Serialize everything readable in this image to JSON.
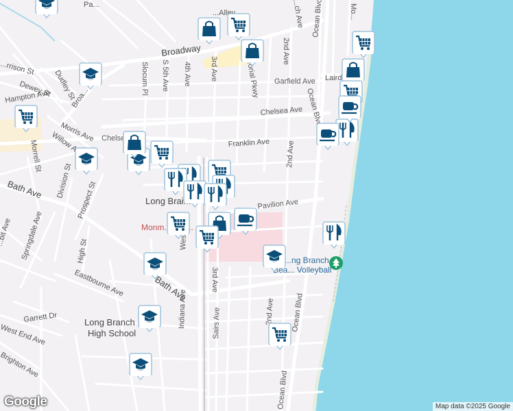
{
  "colors": {
    "water": "#8ed7ea",
    "land": "#f3f1f4",
    "road": "#ffffff",
    "major_road": "#ffffff",
    "highlight_road": "#fdf1c7",
    "mall": "#f7dbe0",
    "marker_fill": "#0b4e7a",
    "park_green": "#1f9e67"
  },
  "streets": {
    "broadway": "Broadway",
    "ocean_blvd_n": "Ocean Blvd",
    "ocean_blvd_mid": "Ocean Blvd",
    "ocean_blvd_s": "Ocean Blvd",
    "ocean_blvd_far_s": "Ocean Blvd",
    "ocean_blvd_top": "Ocean Blvd",
    "second_ave_n": "2nd Ave",
    "second_ave_mid": "2nd Ave",
    "second_ave_s": "2nd Ave",
    "third_ave_n": "3rd Ave",
    "third_ave_s": "3rd Ave",
    "fourth_ave": "4th Ave",
    "s_fifth_ave": "S 5th Ave",
    "slocum_pl": "Slocum Pl",
    "garfield_ave": "Garfield Ave",
    "chelsea_ave": "Chelsea Ave",
    "chelsea_w": "Chelsea",
    "franklin_ave": "Franklin Ave",
    "pavilion_ave": "Pavilion Ave",
    "laird": "Laird",
    "memorial_pkwy": "...orial Pkwy",
    "morris_ave": "Morris Ave",
    "willow_ave": "Willow Ave",
    "morrell_st": "Morrell St",
    "division_st": "Division St",
    "prospect_st": "Prospect St",
    "springdale_ave": "Springdale Ave",
    "high_st": "High St",
    "bath_ave_w": "Bath Ave",
    "bath_ave_e": "Bath Ave",
    "west_ave": "West Ave",
    "indiana_ave": "Indiana Ave",
    "sairs_ave": "Sairs Ave",
    "eastbourne_ave": "Eastbourne Ave",
    "garrett_dr": "Garrett Dr",
    "west_end_ave": "West End Ave",
    "brighton_ave": "Brighton Ave",
    "dudley_st": "Dudley St",
    "dewey_st": "Dewey St",
    "hampton_ave": "Hampton Ave",
    "harrison_st": "...rrison St",
    "broadway_w": "Broa...",
    "alley": "...Alley",
    "bit_ave": "...bit Ave",
    "mo": "Mo...",
    "pa": "Pa...",
    "ch": "...ch Ave"
  },
  "places": {
    "long_branch": "Long Brai...",
    "monmouth_mall": "Monm... Mal...",
    "long_branch_beach_volleyball_1": "...ng Branch",
    "long_branch_beach_volleyball_2": "Bea... Volleyball",
    "high_school_1": "Long Branch",
    "high_school_2": "High School"
  },
  "markers": [
    {
      "type": "school",
      "icon": "graduation-cap-icon"
    },
    {
      "type": "school",
      "icon": "graduation-cap-icon"
    },
    {
      "type": "school",
      "icon": "graduation-cap-icon"
    },
    {
      "type": "school",
      "icon": "graduation-cap-icon"
    },
    {
      "type": "school",
      "icon": "graduation-cap-icon"
    },
    {
      "type": "school",
      "icon": "graduation-cap-icon"
    },
    {
      "type": "school",
      "icon": "graduation-cap-icon"
    },
    {
      "type": "school",
      "icon": "graduation-cap-icon"
    },
    {
      "type": "grocery",
      "icon": "shopping-cart-icon"
    },
    {
      "type": "grocery",
      "icon": "shopping-cart-icon"
    },
    {
      "type": "grocery",
      "icon": "shopping-cart-icon"
    },
    {
      "type": "grocery",
      "icon": "shopping-cart-icon"
    },
    {
      "type": "grocery",
      "icon": "shopping-cart-icon"
    },
    {
      "type": "grocery",
      "icon": "shopping-cart-icon"
    },
    {
      "type": "grocery",
      "icon": "shopping-cart-icon"
    },
    {
      "type": "grocery",
      "icon": "shopping-cart-icon"
    },
    {
      "type": "shopping",
      "icon": "shopping-bag-icon"
    },
    {
      "type": "shopping",
      "icon": "shopping-bag-icon"
    },
    {
      "type": "shopping",
      "icon": "shopping-bag-icon"
    },
    {
      "type": "shopping",
      "icon": "shopping-bag-icon"
    },
    {
      "type": "shopping",
      "icon": "shopping-bag-icon"
    },
    {
      "type": "shopping",
      "icon": "shopping-bag-icon"
    },
    {
      "type": "restaurant",
      "icon": "fork-knife-icon"
    },
    {
      "type": "restaurant",
      "icon": "fork-knife-icon"
    },
    {
      "type": "restaurant",
      "icon": "fork-knife-icon"
    },
    {
      "type": "restaurant",
      "icon": "fork-knife-icon"
    },
    {
      "type": "restaurant",
      "icon": "fork-knife-icon"
    },
    {
      "type": "restaurant",
      "icon": "fork-knife-icon"
    },
    {
      "type": "restaurant",
      "icon": "fork-knife-icon"
    },
    {
      "type": "cafe",
      "icon": "coffee-cup-icon"
    },
    {
      "type": "cafe",
      "icon": "coffee-cup-icon"
    },
    {
      "type": "cafe",
      "icon": "coffee-cup-icon"
    },
    {
      "type": "park",
      "icon": "tree-icon"
    }
  ],
  "attribution": "Map data ©2025 Google",
  "logo": "Google"
}
